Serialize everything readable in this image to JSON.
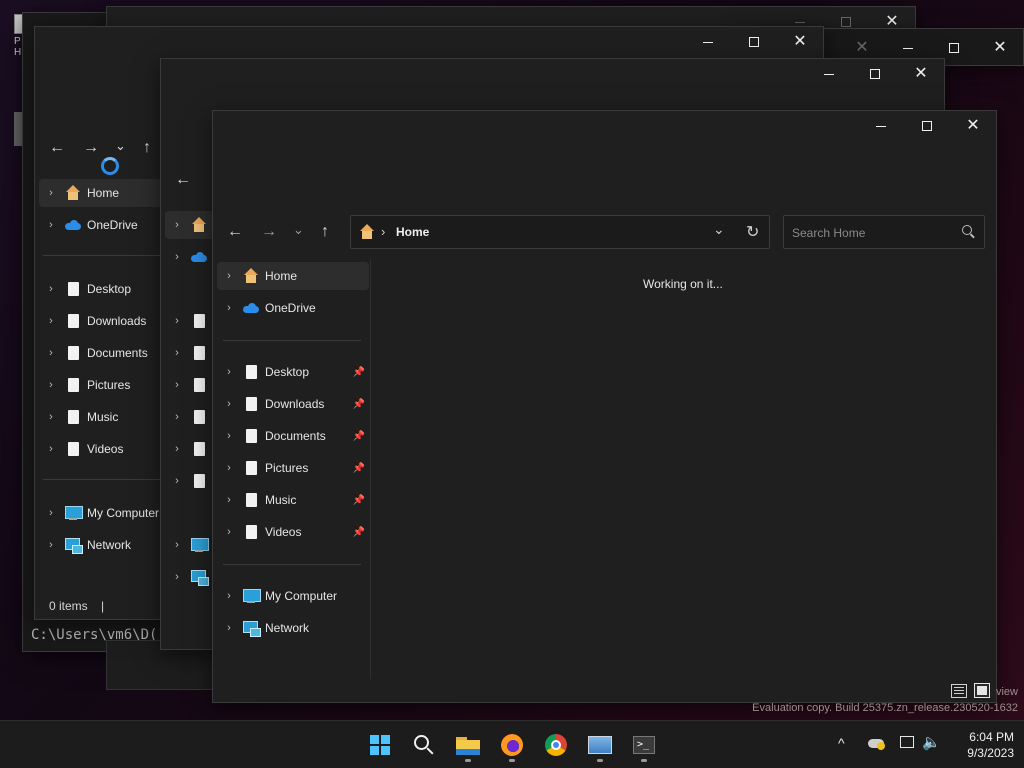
{
  "desktop": {
    "icon_label_1": "P",
    "icon_label_2": "H"
  },
  "console": {
    "prompt": "C:\\Users\\vm6\\D("
  },
  "explorer": {
    "nav": {
      "back": "←",
      "forward": "→",
      "recent": "⌄",
      "up": "↑"
    },
    "address": {
      "icon": "home-icon",
      "separator": "›",
      "location": "Home",
      "dropdown": "⌄",
      "refresh": "↻"
    },
    "search": {
      "placeholder": "Search Home",
      "icon": "search-icon"
    },
    "status_message": "Working on it...",
    "tree": [
      {
        "label": "Home",
        "icon": "home-icon",
        "pinned": false
      },
      {
        "label": "OneDrive",
        "icon": "cloud-icon",
        "pinned": false
      },
      {
        "label": "Desktop",
        "icon": "folder-icon",
        "pinned": true
      },
      {
        "label": "Downloads",
        "icon": "folder-icon",
        "pinned": true
      },
      {
        "label": "Documents",
        "icon": "folder-icon",
        "pinned": true
      },
      {
        "label": "Pictures",
        "icon": "folder-icon",
        "pinned": true
      },
      {
        "label": "Music",
        "icon": "folder-icon",
        "pinned": true
      },
      {
        "label": "Videos",
        "icon": "folder-icon",
        "pinned": true
      },
      {
        "label": "My Computer",
        "icon": "computer-icon",
        "pinned": false
      },
      {
        "label": "Network",
        "icon": "network-icon",
        "pinned": false
      }
    ],
    "back_window": {
      "status": "0 items",
      "cursor": "|",
      "tree_labels": [
        "Home",
        "OneDrive",
        "Desktop",
        "Downloads",
        "Documents",
        "Pictures",
        "Music",
        "Videos",
        "My Computer",
        "Network"
      ]
    },
    "view_buttons": [
      "details-view-icon",
      "large-icons-view-icon"
    ]
  },
  "watermark": {
    "line1": "view",
    "line2": "Evaluation copy. Build 25375.zn_release.230520-1632"
  },
  "taskbar": {
    "apps": [
      "windows-start-icon",
      "search-icon",
      "file-explorer-icon",
      "firefox-icon",
      "chrome-icon",
      "task-manager-icon",
      "terminal-icon"
    ],
    "tray": {
      "chevron": "^",
      "time": "6:04 PM",
      "date": "9/3/2023"
    }
  },
  "colors": {
    "window_bg": "#1f1f1f",
    "accent_blue": "#2b8de8",
    "home_icon": "#e8a95b",
    "text": "#e6e6e6"
  }
}
